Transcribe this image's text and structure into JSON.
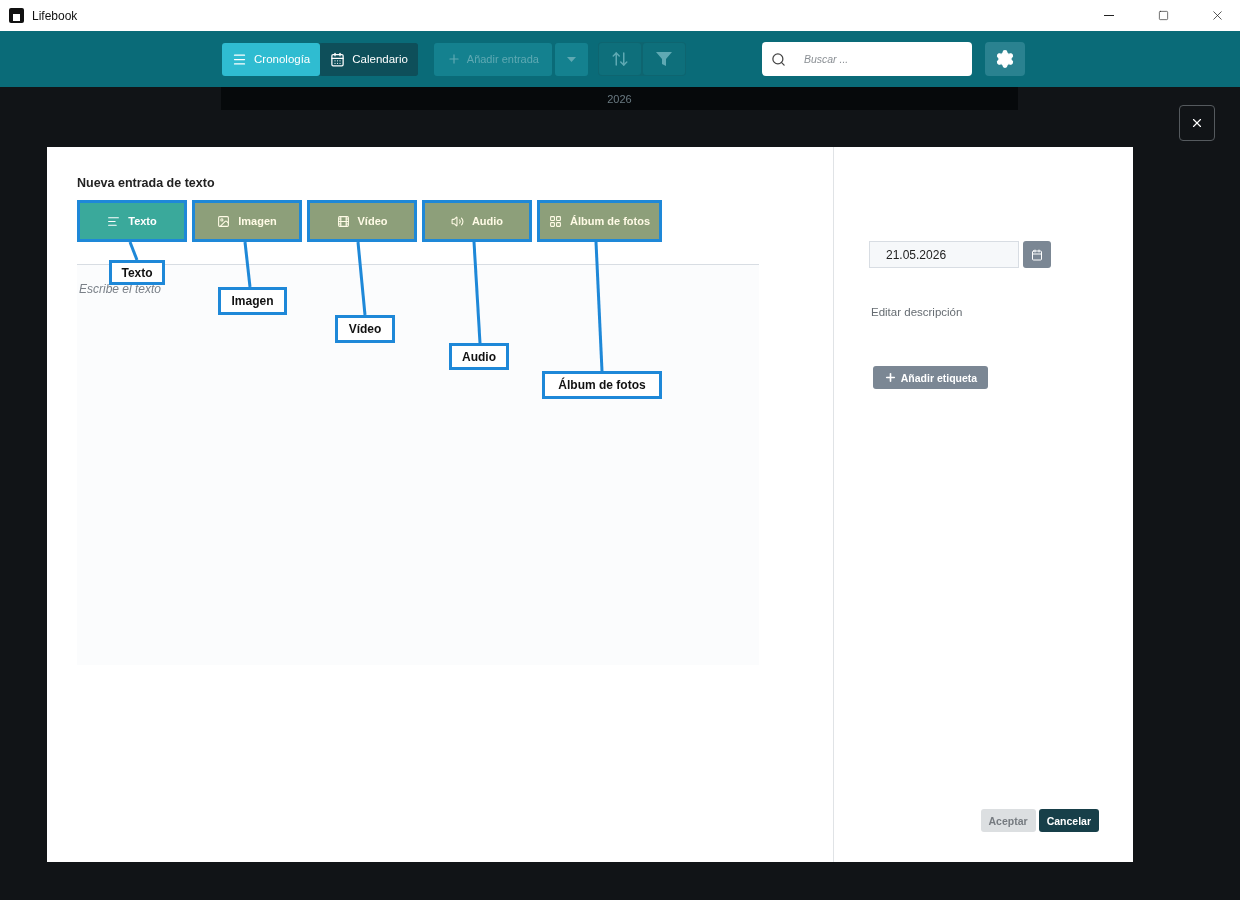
{
  "window": {
    "title": "Lifebook"
  },
  "toolbar": {
    "views": [
      {
        "label": "Cronología",
        "selected": true,
        "kind": "list"
      },
      {
        "label": "Calendario",
        "selected": false,
        "kind": "calendar"
      }
    ],
    "add_button": {
      "label": "Añadir entrada",
      "disabled": true
    },
    "search": {
      "placeholder": "Buscar ..."
    }
  },
  "timeline": {
    "year": "2026"
  },
  "dialog": {
    "title": "Nueva entrada de texto",
    "types": [
      {
        "label": "Texto",
        "selected": true,
        "kind": "text"
      },
      {
        "label": "Imagen",
        "selected": false,
        "kind": "image"
      },
      {
        "label": "Vídeo",
        "selected": false,
        "kind": "video"
      },
      {
        "label": "Audio",
        "selected": false,
        "kind": "audio"
      },
      {
        "label": "Álbum de fotos",
        "selected": false,
        "kind": "album"
      }
    ],
    "text_placeholder": "Escribe el texto",
    "date": "21.05.2026",
    "description_link": "Editar descripción",
    "add_tag": "Añadir etiqueta",
    "buttons": [
      {
        "label": "Aceptar",
        "disabled": true
      },
      {
        "label": "Cancelar",
        "disabled": false
      }
    ]
  },
  "callouts": [
    "Texto",
    "Imagen",
    "Vídeo",
    "Audio",
    "Álbum de fotos"
  ]
}
